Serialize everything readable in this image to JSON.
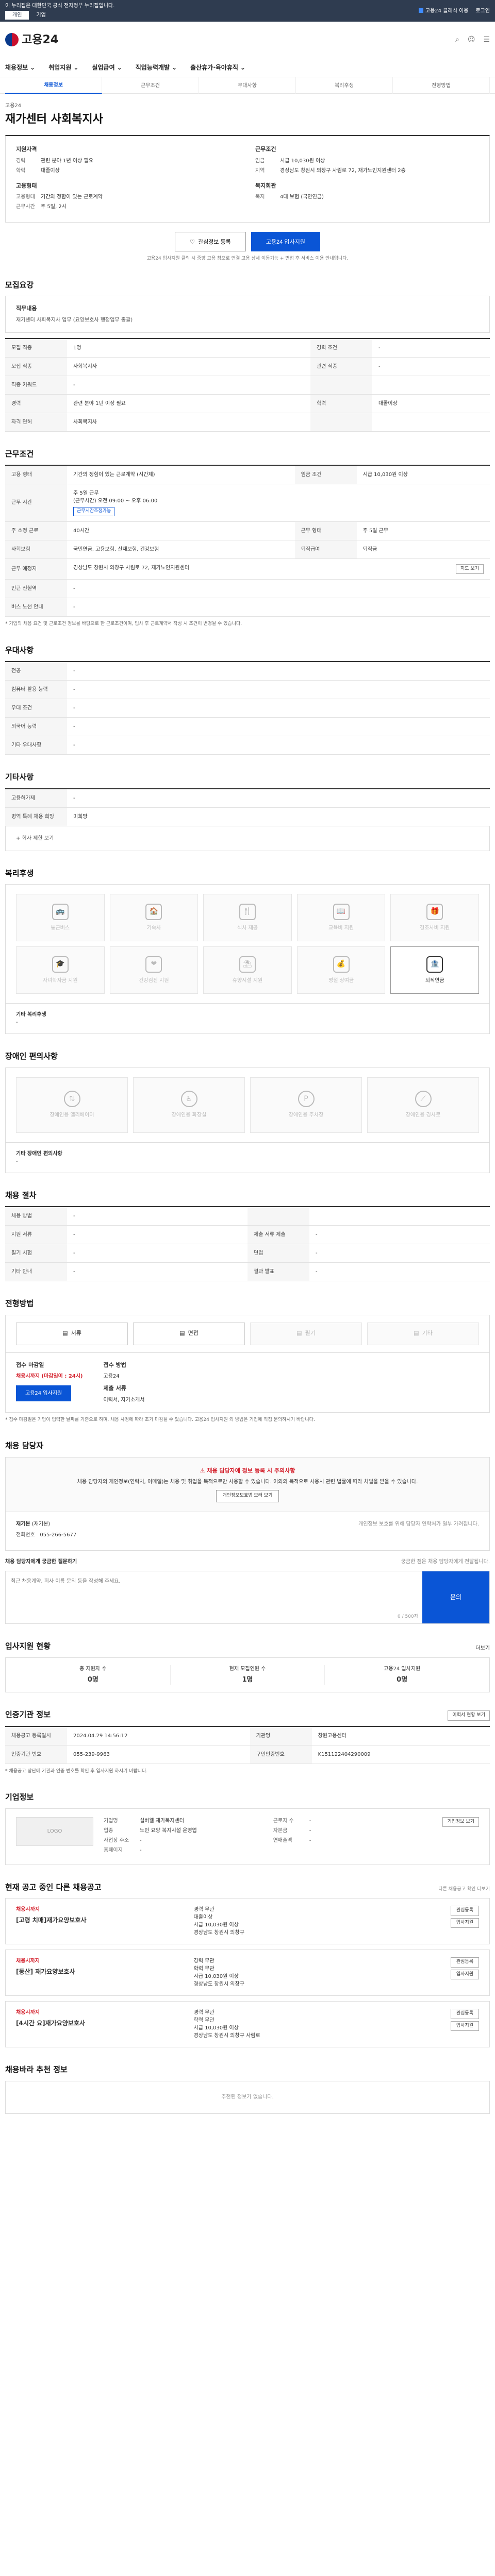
{
  "topbar": {
    "notice": "이 누리집은 대한민국 공식 전자정부 누리집입니다.",
    "tab_personal": "개인",
    "tab_company": "기업",
    "user": "고용24 클래식 이용",
    "login": "로그인"
  },
  "header": {
    "logo": "고용24"
  },
  "gnb": [
    "채용정보",
    "취업지원",
    "실업급여",
    "직업능력개발",
    "출산휴가·육아휴직"
  ],
  "subnav": [
    "채용정보",
    "근무조건",
    "우대사항",
    "복리후생",
    "전형방법"
  ],
  "job": {
    "company": "고용24",
    "title": "재가센터 사회복지사"
  },
  "summary": {
    "left_title": "지원자격",
    "left": [
      {
        "k": "경력",
        "v": "관련 분야 1년 이상 필요"
      },
      {
        "k": "학력",
        "v": "대졸이상"
      }
    ],
    "right_title": "근무조건",
    "right": [
      {
        "k": "임금",
        "v": "시급 10,030원 이상"
      },
      {
        "k": "지역",
        "v": "경상남도 창원시 의창구 사림로 72, 재가노인지원센터 2층"
      }
    ],
    "left2_title": "고용형태",
    "left2": [
      {
        "k": "고용형태",
        "v": "기간의 정함이 있는 근로계약"
      },
      {
        "k": "근무시간",
        "v": "주 5일, 2시"
      }
    ],
    "right2_title": "복지회관",
    "right2": [
      {
        "k": "복지",
        "v": "4대 보험 (국민연금)"
      }
    ]
  },
  "actions": {
    "scrap": "관심정보 등록",
    "apply": "고용24 입사지원"
  },
  "notice": "고용24 입사지원 클릭 시 중앙 고용 창으로 연결 고용 상세 이동기능 + 면접 후 서비스 이용 안내입니다.",
  "sec_job": {
    "title": "모집요강",
    "h": "직무내용",
    "p": "재가센터 사회복지사 업무 (요양보호사 행정업무 총괄)"
  },
  "req_rows": [
    [
      {
        "k": "모집 직종",
        "v": "1명"
      },
      {
        "k": "경력 조건",
        "v": "-"
      }
    ],
    [
      {
        "k": "모집 직종",
        "v": "사회복지사"
      },
      {
        "k": "관련 직종",
        "v": "-"
      }
    ],
    [
      {
        "k": "직종 키워드",
        "v": "-"
      },
      {
        "k": "",
        "v": ""
      }
    ],
    [
      {
        "k": "경력",
        "v": "관련 분야 1년 이상 필요"
      },
      {
        "k": "학력",
        "v": "대졸이상"
      }
    ],
    [
      {
        "k": "자격 면허",
        "v": "사회복지사"
      },
      {
        "k": "",
        "v": ""
      }
    ]
  ],
  "sec_cond": {
    "title": "근무조건",
    "rows": [
      {
        "k": "고용 형태",
        "v": "기간의 정함이 있는 근로계약 (시간제)",
        "k2": "임금 조건",
        "v2": "시급 10,030원 이상"
      },
      {
        "k": "근무 시간",
        "v": "주 5일 근무",
        "v_sub": "(근무시간) 오전 09:00 ~ 오후 06:00",
        "tag": "근무시간조정가능"
      },
      {
        "k": "주 소정 근로",
        "v": "40시간",
        "k2": "근무 형태",
        "v2": "주 5일 근무"
      },
      {
        "k": "사회보험",
        "v": "국민연금, 고용보험, 산재보험, 건강보험",
        "k2": "퇴직급여",
        "v2": "퇴직금"
      },
      {
        "k": "근무 예정지",
        "v": "경상남도 창원시 의창구 사림로 72, 재가노인지원센터",
        "btn": "지도 보기"
      },
      {
        "k": "인근 전철역",
        "v": "-"
      },
      {
        "k": "버스 노선 안내",
        "v": "-"
      }
    ],
    "foot": "* 기업의 채용 요건 및 근로조건 정보를 바탕으로 한 근로조건이며, 입사 후 근로계약서 작성 시 조건이 변경될 수 있습니다."
  },
  "sec_pref": {
    "title": "우대사항",
    "rows": [
      {
        "k": "전공",
        "v": "-"
      },
      {
        "k": "컴퓨터 활용 능력",
        "v": "-"
      },
      {
        "k": "우대 조건",
        "v": "-"
      },
      {
        "k": "외국어 능력",
        "v": "-"
      },
      {
        "k": "기타 우대사항",
        "v": "-"
      }
    ]
  },
  "sec_etc": {
    "title": "기타사항",
    "rows": [
      {
        "k": "고용허가제",
        "v": "-"
      },
      {
        "k": "병역 특례 채용 희망",
        "v": "미희망"
      }
    ],
    "more": "+ 회사 제한 보기"
  },
  "sec_welfare": {
    "title": "복리후생",
    "items": [
      {
        "l": "통근버스",
        "on": false,
        "i": "🚌"
      },
      {
        "l": "기숙사",
        "on": false,
        "i": "🏠"
      },
      {
        "l": "식사 제공",
        "on": false,
        "i": "🍴"
      },
      {
        "l": "교육비 지원",
        "on": false,
        "i": "📖"
      },
      {
        "l": "경조사비 지원",
        "on": false,
        "i": "🎁"
      },
      {
        "l": "자녀학자금 지원",
        "on": false,
        "i": "🎓"
      },
      {
        "l": "건강검진 지원",
        "on": false,
        "i": "❤"
      },
      {
        "l": "휴양시설 지원",
        "on": false,
        "i": "⛱"
      },
      {
        "l": "명절 상여금",
        "on": false,
        "i": "💰"
      },
      {
        "l": "퇴직연금",
        "on": true,
        "i": "🏦"
      }
    ],
    "etc_title": "기타 복리후생",
    "etc": "-"
  },
  "sec_disab": {
    "title": "장애인 편의사항",
    "items": [
      {
        "l": "장애인용 엘리베이터"
      },
      {
        "l": "장애인용 화장실"
      },
      {
        "l": "장애인용 주차장"
      },
      {
        "l": "장애인용 경사로"
      }
    ],
    "etc_title": "기타 장애인 편의사항",
    "etc": "-"
  },
  "sec_proc": {
    "title": "채용 절차",
    "rows": [
      [
        {
          "k": "채용 방법",
          "v": "-"
        },
        {
          "k": "",
          "v": ""
        }
      ],
      [
        {
          "k": "지원 서류",
          "v": "-"
        },
        {
          "k": "제출 서류 제출",
          "v": "-"
        }
      ],
      [
        {
          "k": "필기 시험",
          "v": "-"
        },
        {
          "k": "면접",
          "v": "-"
        }
      ],
      [
        {
          "k": "기타 안내",
          "v": "-"
        },
        {
          "k": "결과 발표",
          "v": "-"
        }
      ]
    ]
  },
  "sec_method": {
    "title": "전형방법",
    "methods": [
      {
        "l": "서류",
        "on": true
      },
      {
        "l": "면접",
        "on": true
      },
      {
        "l": "필기",
        "on": false
      },
      {
        "l": "기타",
        "on": false
      }
    ],
    "apply_title": "접수 마감일",
    "apply_red": "채용시까지 (마감일이 : 24시)",
    "apply_btn": "고용24 입사지원",
    "mthd_title": "접수 방법",
    "mthd": "고용24",
    "doc_title": "제출 서류",
    "doc": "이력서, 자기소개서",
    "foot": "* 접수 마감일은 기업이 입력한 날짜를 기준으로 하며, 채용 사정에 따라 조기 마감될 수 있습니다. 고용24 입사지원 외 방법은 기업에 직접 문의하시기 바랍니다."
  },
  "sec_contact": {
    "title": "채용 담당자",
    "warn_title": "채용 담당자에 정보 등록 시 주의사항",
    "warn": "채용 담당자의 개인정보(연락처, 이메일)는 채용 및 취업을 목적으로만 사용할 수 있습니다. 이외의 목적으로 사용시 관련 법률에 따라 처벌을 받을 수 있습니다.",
    "warn_btn": "개인정보보호법 보러 보기",
    "name_k": "재기본",
    "name_v": "(재기본)",
    "phone_k": "전화번호",
    "phone_v": "055-266-5677",
    "right_note": "개인정보 보호를 위해 담당자 연락처가 일부 가려집니다.",
    "inq_title": "채용 담당자에게 궁금한 질문하기",
    "inq_right": "궁금한 점은 채용 담당자에게 전달됩니다.",
    "inq_ph": "최근 채용계약, 회사 이름 문의 등을 작성해 주세요.",
    "inq_count": "0 / 500자",
    "inq_send": "문의"
  },
  "sec_status": {
    "title": "입사지원 현황",
    "more": "더보기",
    "cells": [
      {
        "l": "총 지원자 수",
        "v": "0명"
      },
      {
        "l": "현재 모집인원 수",
        "v": "1명"
      },
      {
        "l": "고용24 입사지원",
        "v": "0명"
      }
    ]
  },
  "sec_info": {
    "title": "인증기관 정보",
    "btn": "이력서 현황 보기",
    "rows": [
      [
        {
          "k": "채용공고 등록일시",
          "v": "2024.04.29 14:56:12"
        },
        {
          "k": "기관명",
          "v": "창원고용센터"
        }
      ],
      [
        {
          "k": "인증기관 번호",
          "v": "055-239-9963"
        },
        {
          "k": "구인인증번호",
          "v": "K151122404290009"
        }
      ]
    ],
    "foot": "* 채용공고 상단에 기관과 인증 번호를 확인 후 입사지원 하시기 바랍니다."
  },
  "sec_comp": {
    "title": "기업정보",
    "logo": "LOGO",
    "btn": "기업정보 보기",
    "name_k": "기업명",
    "name_v": "실버웰 재가복지센터",
    "emp_k": "근로자 수",
    "emp_v": "-",
    "ind_k": "업종",
    "ind_v": "노인 요양 복지시설 운영업",
    "cap_k": "자본금",
    "cap_v": "-",
    "addr_k": "사업장 주소",
    "addr_v": "-",
    "sales_k": "연매출액",
    "sales_v": "-",
    "hp_k": "홈페이지",
    "hp_v": "-"
  },
  "sec_jobs": {
    "title": "현재 공고 중인 다른 채용공고",
    "more": "다른 채용공고 확인 더보기",
    "cards": [
      {
        "deadline": "채용시까지",
        "title": "[고령 치매]재가요양보호사",
        "c1": "경력 무관",
        "c2": "대졸이상",
        "c3": "시급 10,030원 이상",
        "c4": "경상남도 창원시 의창구",
        "b1": "관심등록",
        "b2": "입사지원"
      },
      {
        "deadline": "채용시까지",
        "title": "[동산] 재가요양보호사",
        "c1": "경력 무관",
        "c2": "학력 무관",
        "c3": "시급 10,030원 이상",
        "c4": "경상남도 창원시 의창구",
        "b1": "관심등록",
        "b2": "입사지원"
      },
      {
        "deadline": "채용시까지",
        "title": "[4시간 요]재가요양보호사",
        "c1": "경력 무관",
        "c2": "학력 무관",
        "c3": "시급 10,030원 이상",
        "c4": "경상남도 창원시 의창구 사림로",
        "b1": "관심등록",
        "b2": "입사지원"
      }
    ]
  },
  "sec_rec": {
    "title": "채용바라 추천 정보",
    "empty": "추천된 정보가 없습니다."
  }
}
